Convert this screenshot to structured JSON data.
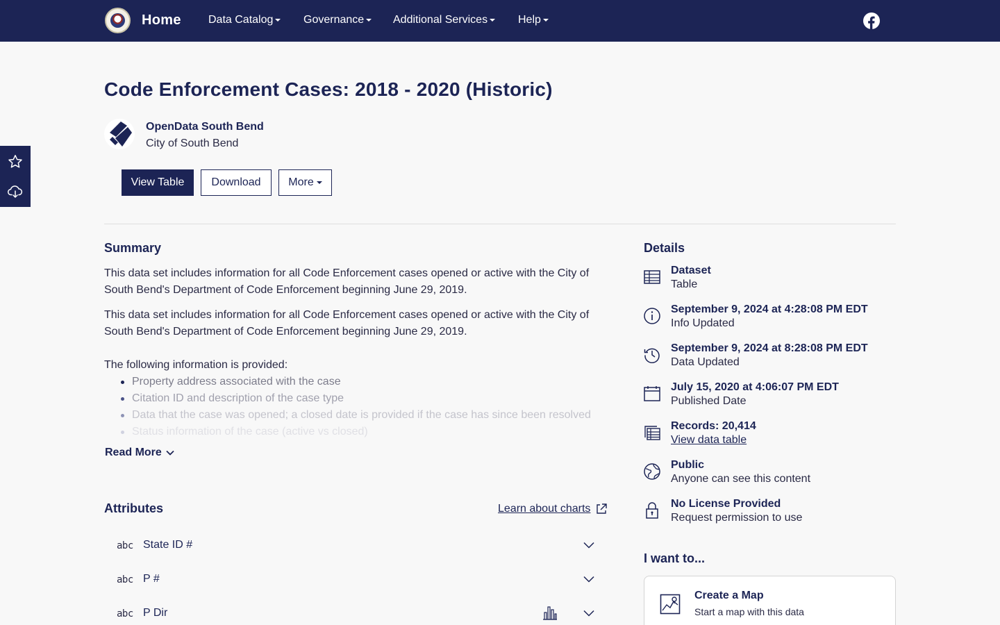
{
  "nav": {
    "home": "Home",
    "items": [
      "Data Catalog",
      "Governance",
      "Additional Services",
      "Help"
    ]
  },
  "page": {
    "title": "Code Enforcement Cases: 2018 - 2020 (Historic)",
    "org_name": "OpenData South Bend",
    "org_sub": "City of South Bend"
  },
  "actions": {
    "view_table": "View Table",
    "download": "Download",
    "more": "More"
  },
  "summary": {
    "heading": "Summary",
    "para1": "This data set includes information for all Code Enforcement cases opened or active with the City of South Bend's Department of Code Enforcement beginning June 29, 2019.",
    "para2": "This data set includes information for all Code Enforcement cases opened or active with the City of South Bend's Department of Code Enforcement beginning June 29, 2019.",
    "list_intro": "The following information is provided:",
    "list": [
      "Property address associated with the case",
      "Citation ID and description of the case type",
      "Data that the case was opened; a closed date is provided if the case has since been resolved",
      "Status information of the case (active vs closed)"
    ],
    "read_more": "Read More"
  },
  "attributes": {
    "heading": "Attributes",
    "learn_link": "Learn about charts",
    "rows": [
      {
        "type": "abc",
        "name": "State ID #"
      },
      {
        "type": "abc",
        "name": "P #"
      },
      {
        "type": "abc",
        "name": "P Dir"
      }
    ]
  },
  "details": {
    "heading": "Details",
    "items": [
      {
        "icon": "table-icon",
        "title": "Dataset",
        "sub": "Table"
      },
      {
        "icon": "info-icon",
        "title": "September 9, 2024 at 4:28:08 PM EDT",
        "sub": "Info Updated"
      },
      {
        "icon": "history-icon",
        "title": "September 9, 2024 at 8:28:08 PM EDT",
        "sub": "Data Updated"
      },
      {
        "icon": "calendar-icon",
        "title": "July 15, 2020 at 4:06:07 PM EDT",
        "sub": "Published Date"
      },
      {
        "icon": "records-icon",
        "title": "Records: 20,414",
        "sub": "View data table"
      },
      {
        "icon": "globe-icon",
        "title": "Public",
        "sub": "Anyone can see this content"
      },
      {
        "icon": "lock-icon",
        "title": "No License Provided",
        "sub": "Request permission to use"
      }
    ]
  },
  "i_want_to": {
    "heading": "I want to...",
    "card_title": "Create a Map",
    "card_sub": "Start a map with this data"
  },
  "colors": {
    "brand": "#1c2455",
    "background": "#f8f8f8"
  }
}
